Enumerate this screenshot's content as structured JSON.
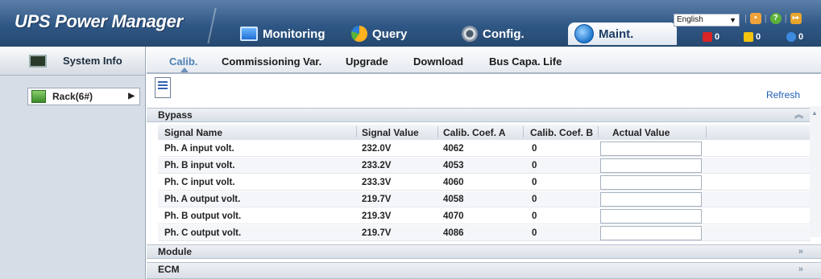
{
  "app": {
    "title": "UPS Power Manager"
  },
  "nav": {
    "tabs": [
      {
        "label": "Monitoring",
        "icon": "monitor-icon"
      },
      {
        "label": "Query",
        "icon": "pie-chart-icon"
      },
      {
        "label": "Config.",
        "icon": "gear-icon"
      },
      {
        "label": "Maint.",
        "icon": "globe-icon",
        "active": true
      }
    ]
  },
  "header": {
    "language": "English",
    "alarms": [
      {
        "count": "0",
        "color": "#d92525",
        "icon": "critical-alarm-icon"
      },
      {
        "count": "0",
        "color": "#f2c40e",
        "icon": "major-alarm-icon"
      },
      {
        "count": "0",
        "color": "#3d8be0",
        "icon": "info-alarm-icon"
      }
    ]
  },
  "sidebar": {
    "system_info": "System Info",
    "rack": "Rack(6#)"
  },
  "subtabs": [
    {
      "label": "Calib.",
      "active": true
    },
    {
      "label": "Commissioning Var."
    },
    {
      "label": "Upgrade"
    },
    {
      "label": "Download"
    },
    {
      "label": "Bus Capa. Life"
    }
  ],
  "toolbar": {
    "refresh": "Refresh"
  },
  "sections": {
    "bypass": "Bypass",
    "module": "Module",
    "ecm": "ECM"
  },
  "table": {
    "columns": [
      "Signal Name",
      "Signal Value",
      "Calib. Coef. A",
      "Calib. Coef. B",
      "Actual Value"
    ],
    "rows": [
      {
        "name": "Ph. A input volt.",
        "value": "232.0V",
        "coef_a": "4062",
        "coef_b": "0",
        "actual": ""
      },
      {
        "name": "Ph. B input volt.",
        "value": "233.2V",
        "coef_a": "4053",
        "coef_b": "0",
        "actual": ""
      },
      {
        "name": "Ph. C input volt.",
        "value": "233.3V",
        "coef_a": "4060",
        "coef_b": "0",
        "actual": ""
      },
      {
        "name": "Ph. A output volt.",
        "value": "219.7V",
        "coef_a": "4058",
        "coef_b": "0",
        "actual": ""
      },
      {
        "name": "Ph. B output volt.",
        "value": "219.3V",
        "coef_a": "4070",
        "coef_b": "0",
        "actual": ""
      },
      {
        "name": "Ph. C output volt.",
        "value": "219.7V",
        "coef_a": "4086",
        "coef_b": "0",
        "actual": ""
      }
    ]
  }
}
